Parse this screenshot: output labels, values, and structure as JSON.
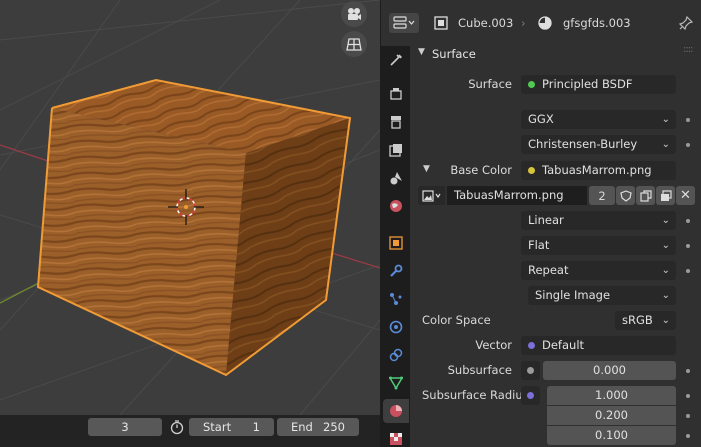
{
  "viewport": {
    "icons": [
      "camera-view-icon",
      "grid-view-icon"
    ]
  },
  "timeline": {
    "current_frame": "3",
    "start_label": "Start",
    "start_value": "1",
    "end_label": "End",
    "end_value": "250"
  },
  "header": {
    "object_name": "Cube.003",
    "material_name": "gfsgfds.003"
  },
  "surface_panel": {
    "title": "Surface",
    "surface_label": "Surface",
    "surface_value": "Principled BSDF",
    "distribution": "GGX",
    "subsurface_method": "Christensen-Burley",
    "base_color_label": "Base Color",
    "base_color_value": "TabuasMarrom.png",
    "image_name": "TabuasMarrom.png",
    "image_users": "2",
    "interpolation": "Linear",
    "projection": "Flat",
    "extension": "Repeat",
    "source": "Single Image",
    "color_space_label": "Color Space",
    "color_space_value": "sRGB",
    "vector_label": "Vector",
    "vector_value": "Default",
    "subsurface_label": "Subsurface",
    "subsurface_value": "0.000",
    "subsurface_radius_label": "Subsurface Radius",
    "subsurface_radius_values": [
      "1.000",
      "0.200",
      "0.100"
    ]
  },
  "colors": {
    "accent_orange": "#f19b36",
    "socket_green": "#4fc94f",
    "socket_yellow": "#d7c43b",
    "socket_purple": "#7c6fd9",
    "socket_gray": "#9a9a9a"
  }
}
